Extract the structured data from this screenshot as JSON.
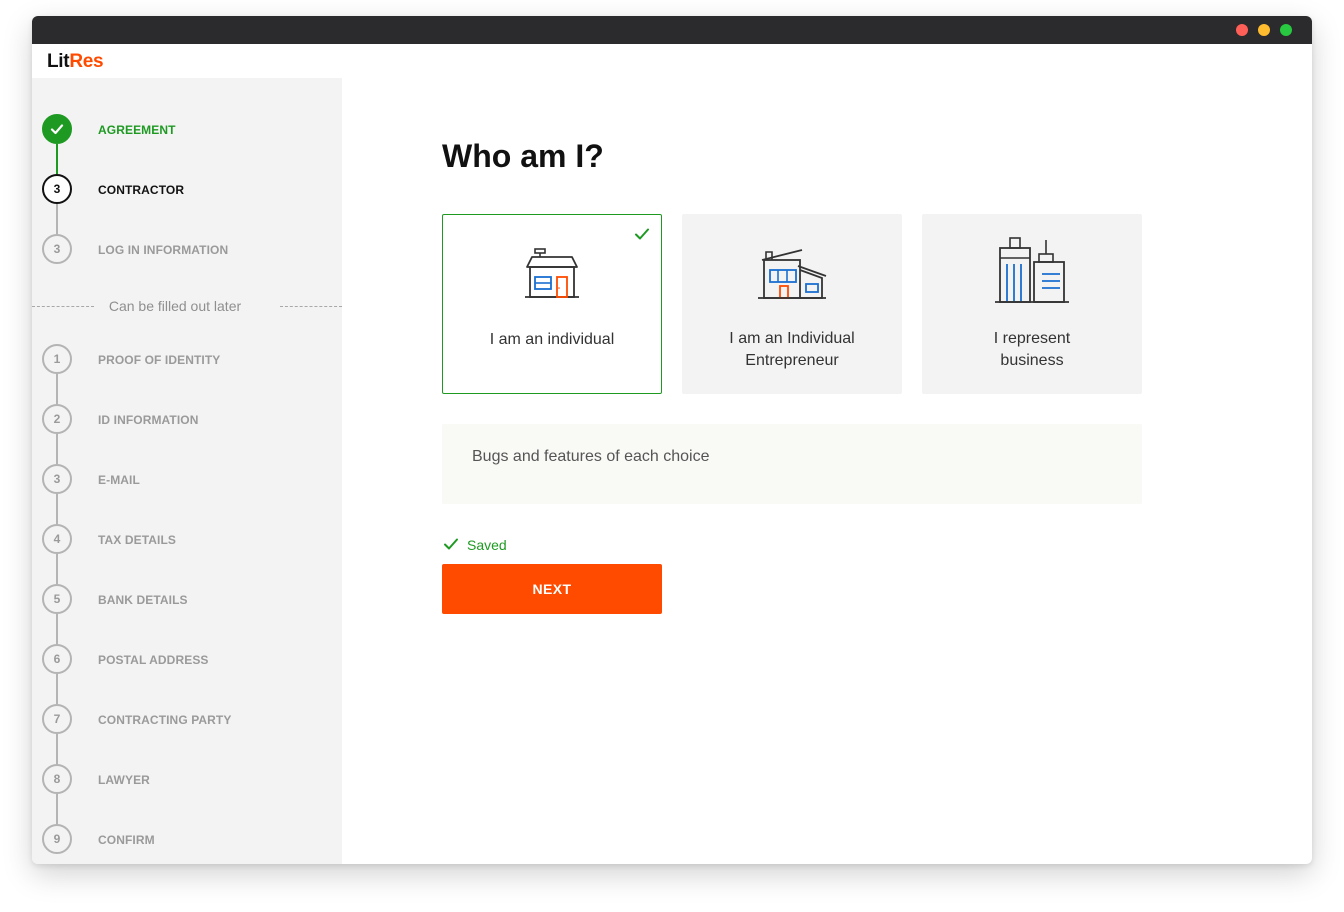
{
  "window": {
    "dots": [
      {
        "name": "close",
        "color": "#ff5f57"
      },
      {
        "name": "minimize",
        "color": "#febc2e"
      },
      {
        "name": "maximize",
        "color": "#28c840"
      }
    ]
  },
  "logo": {
    "part1": "Lit",
    "part2": "Res"
  },
  "sidebar": {
    "steps_top": [
      {
        "number": "",
        "label": "AGREEMENT",
        "status": "done",
        "icon": "check-icon"
      },
      {
        "number": "3",
        "label": "CONTRACTOR",
        "status": "current"
      },
      {
        "number": "3",
        "label": "LOG IN INFORMATION",
        "status": "pending"
      }
    ],
    "later_text": "Can be filled out later",
    "steps_later": [
      {
        "number": "1",
        "label": "PROOF OF IDENTITY"
      },
      {
        "number": "2",
        "label": "ID INFORMATION"
      },
      {
        "number": "3",
        "label": "E-MAIL"
      },
      {
        "number": "4",
        "label": "TAX DETAILS"
      },
      {
        "number": "5",
        "label": "BANK DETAILS"
      },
      {
        "number": "6",
        "label": "POSTAL ADDRESS"
      },
      {
        "number": "7",
        "label": "CONTRACTING PARTY"
      },
      {
        "number": "8",
        "label": "LAWYER"
      },
      {
        "number": "9",
        "label": "CONFIRM"
      }
    ]
  },
  "main": {
    "title": "Who am I?",
    "options": [
      {
        "line1": "I am an individual",
        "line2": "",
        "icon": "house-icon",
        "selected": true
      },
      {
        "line1": "I am an Individual",
        "line2": "Entrepreneur",
        "icon": "shop-building-icon",
        "selected": false
      },
      {
        "line1": "I represent",
        "line2": "business",
        "icon": "office-buildings-icon",
        "selected": false
      }
    ],
    "info": "Bugs and features of each choice",
    "saved": "Saved",
    "next": "NEXT"
  },
  "colors": {
    "accent": "#ff4b00",
    "success": "#1e9a23",
    "icon_blue": "#1a6fd1",
    "sidebar_bg": "#f3f3f3"
  }
}
